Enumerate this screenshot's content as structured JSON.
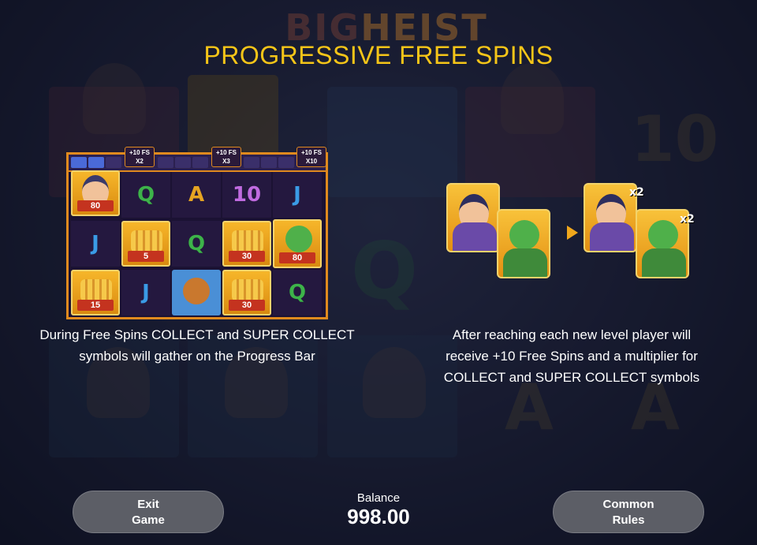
{
  "logo": {
    "part1": "BIG",
    "part2": "HEIST"
  },
  "title": "PROGRESSIVE FREE SPINS",
  "progress_bar": {
    "markers": [
      {
        "line1": "+10 FS",
        "line2": "X2"
      },
      {
        "line1": "+10 FS",
        "line2": "X3"
      },
      {
        "line1": "+10 FS",
        "line2": "X10"
      }
    ]
  },
  "grid": {
    "cells": [
      {
        "symbol": "robber-collect",
        "value": "80"
      },
      {
        "symbol": "Q"
      },
      {
        "symbol": "A"
      },
      {
        "symbol": "10"
      },
      {
        "symbol": "J"
      },
      {
        "symbol": "J"
      },
      {
        "symbol": "coins",
        "value": "5"
      },
      {
        "symbol": "Q"
      },
      {
        "symbol": "coins",
        "value": "30"
      },
      {
        "symbol": "super-collect",
        "value": "80"
      },
      {
        "symbol": "coins",
        "value": "15"
      },
      {
        "symbol": "J"
      },
      {
        "symbol": "dog"
      },
      {
        "symbol": "coins",
        "value": "30"
      },
      {
        "symbol": "Q"
      }
    ]
  },
  "left_description": {
    "line1": "During Free Spins COLLECT and SUPER COLLECT",
    "line2": "symbols will gather on the Progress Bar"
  },
  "right_illustration": {
    "mult1": "x2",
    "mult2": "x2"
  },
  "right_description": {
    "line1": "After reaching each new level player will",
    "line2": "receive +10 Free Spins and a multiplier for",
    "line3": "COLLECT and SUPER COLLECT symbols"
  },
  "footer": {
    "exit_line1": "Exit",
    "exit_line2": "Game",
    "balance_label": "Balance",
    "balance_value": "998.00",
    "rules_line1": "Common",
    "rules_line2": "Rules"
  },
  "colors": {
    "title": "#f5c518",
    "frame": "#e08a1e",
    "button": "#5c5e66",
    "progress_fill": "#4a6ad8"
  },
  "icons": [
    "robber-icon",
    "super-collect-icon",
    "dog-icon",
    "coins-icon",
    "arrow-right-icon"
  ]
}
